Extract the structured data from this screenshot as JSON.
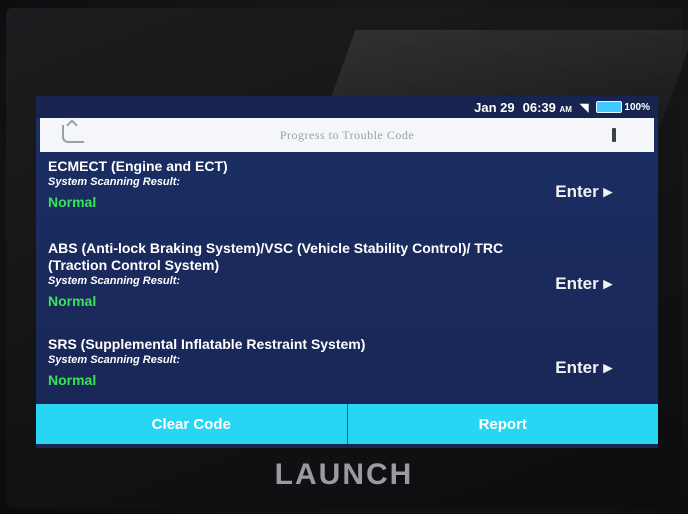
{
  "status": {
    "date": "Jan 29",
    "time": "06:39",
    "ampm": "AM",
    "battery": "100%"
  },
  "header": {
    "title": "Progress to Trouble Code"
  },
  "systems": [
    {
      "name": "ECMECT (Engine and ECT)",
      "label": "System Scanning Result:",
      "result": "Normal",
      "action": "Enter ▸"
    },
    {
      "name": "ABS (Anti-lock Braking System)/VSC (Vehicle Stability Control)/ TRC (Traction Control System)",
      "label": "System Scanning Result:",
      "result": "Normal",
      "action": "Enter ▸"
    },
    {
      "name": "SRS (Supplemental Inflatable Restraint System)",
      "label": "System Scanning Result:",
      "result": "Normal",
      "action": "Enter ▸"
    }
  ],
  "buttons": {
    "clear": "Clear Code",
    "report": "Report"
  },
  "brand": "LAUNCH",
  "colors": {
    "screen": "#1a2a5c",
    "normal": "#39e35a",
    "buttons": "#28d5f2"
  }
}
